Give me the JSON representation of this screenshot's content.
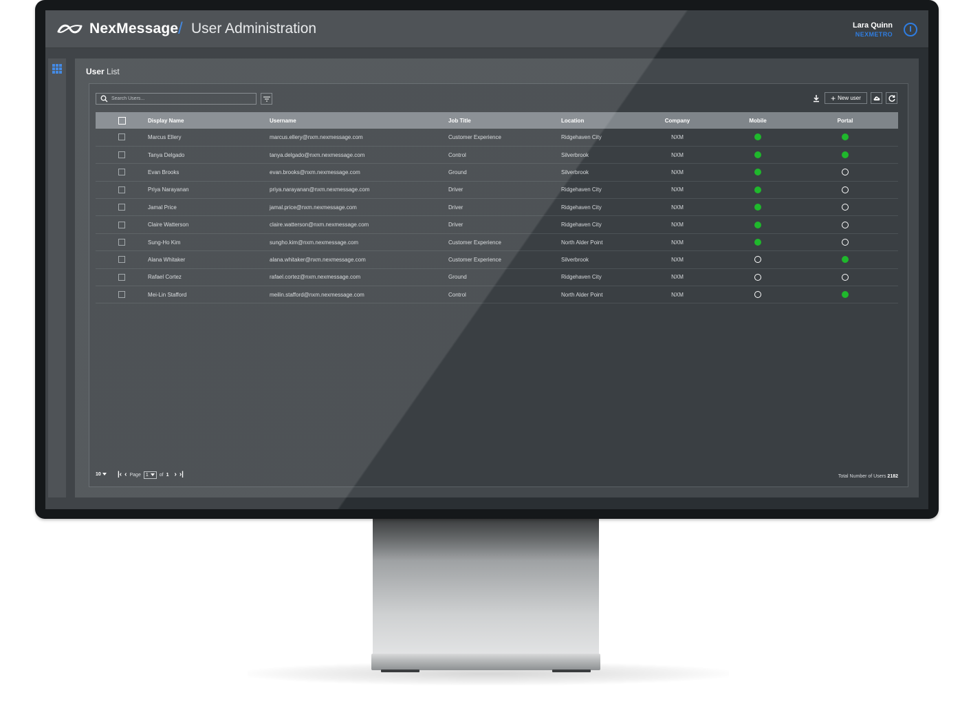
{
  "header": {
    "brand": "NexMessage",
    "separator": "/",
    "title": "User Administration",
    "user_name": "Lara Quinn",
    "user_org": "NEXMETRO"
  },
  "panel": {
    "title_bold": "User",
    "title_light": "List"
  },
  "toolbar": {
    "search_placeholder": "Search Users...",
    "new_user_label": "New user"
  },
  "table": {
    "columns": [
      "Display Name",
      "Username",
      "Job Title",
      "Location",
      "Company",
      "Mobile",
      "Portal"
    ],
    "rows": [
      {
        "name": "Marcus Ellery",
        "username": "marcus.ellery@nxm.nexmessage.com",
        "job": "Customer Experience",
        "location": "Ridgehaven City",
        "company": "NXM",
        "mobile": true,
        "portal": true
      },
      {
        "name": "Tanya Delgado",
        "username": "tanya.delgado@nxm.nexmessage.com",
        "job": "Control",
        "location": "Silverbrook",
        "company": "NXM",
        "mobile": true,
        "portal": true
      },
      {
        "name": "Evan Brooks",
        "username": "evan.brooks@nxm.nexmessage.com",
        "job": "Ground",
        "location": "Silverbrook",
        "company": "NXM",
        "mobile": true,
        "portal": false
      },
      {
        "name": "Priya Narayanan",
        "username": "priya.narayanan@nxm.nexmessage.com",
        "job": "Driver",
        "location": "Ridgehaven City",
        "company": "NXM",
        "mobile": true,
        "portal": false
      },
      {
        "name": "Jamal Price",
        "username": "jamal.price@nxm.nexmessage.com",
        "job": "Driver",
        "location": "Ridgehaven City",
        "company": "NXM",
        "mobile": true,
        "portal": false
      },
      {
        "name": "Claire Watterson",
        "username": "claire.watterson@nxm.nexmessage.com",
        "job": "Driver",
        "location": "Ridgehaven City",
        "company": "NXM",
        "mobile": true,
        "portal": false
      },
      {
        "name": "Sung-Ho Kim",
        "username": "sungho.kim@nxm.nexmessage.com",
        "job": "Customer Experience",
        "location": "North Alder Point",
        "company": "NXM",
        "mobile": true,
        "portal": false
      },
      {
        "name": "Alana Whitaker",
        "username": "alana.whitaker@nxm.nexmessage.com",
        "job": "Customer Experience",
        "location": "Silverbrook",
        "company": "NXM",
        "mobile": false,
        "portal": true
      },
      {
        "name": "Rafael Cortez",
        "username": "rafael.cortez@nxm.nexmessage.com",
        "job": "Ground",
        "location": "Ridgehaven City",
        "company": "NXM",
        "mobile": false,
        "portal": false
      },
      {
        "name": "Mei-Lin Stafford",
        "username": "meilin.stafford@nxm.nexmessage.com",
        "job": "Control",
        "location": "North Alder Point",
        "company": "NXM",
        "mobile": false,
        "portal": true
      }
    ]
  },
  "footer": {
    "page_size": "10",
    "page_label": "Page",
    "current_page": "1",
    "of_label": "of",
    "total_pages": "1",
    "total_users_label": "Total Number of Users",
    "total_users": "2182"
  },
  "colors": {
    "accent": "#2f7de1",
    "status_on": "#1fb82c",
    "background": "#2a2f33"
  },
  "icons": [
    "logo-icon",
    "power-icon",
    "apps-grid-icon",
    "search-icon",
    "filter-icon",
    "download-icon",
    "plus-icon",
    "cloud-upload-icon",
    "refresh-icon",
    "first-page-icon",
    "previous-page-icon",
    "next-page-icon",
    "last-page-icon"
  ]
}
